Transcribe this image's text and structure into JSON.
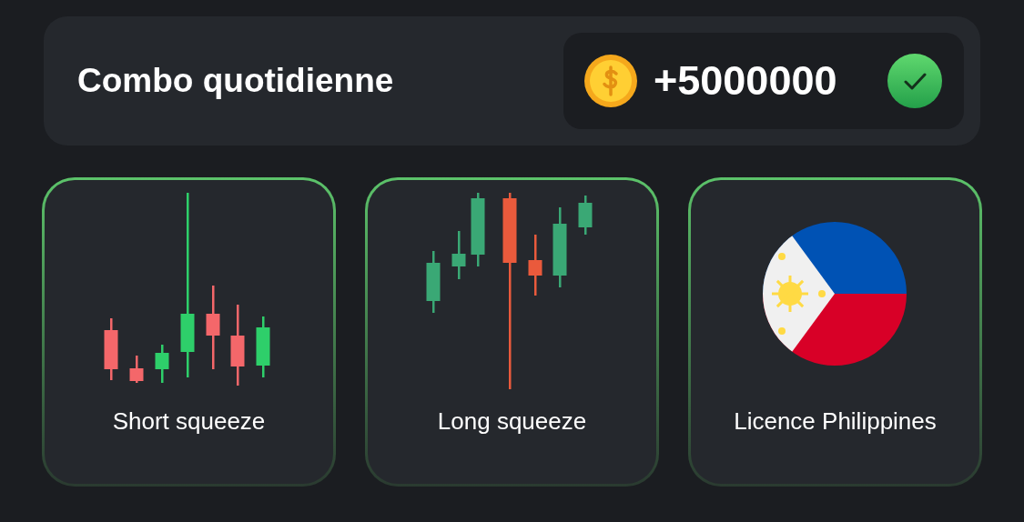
{
  "header": {
    "title": "Combo quotidienne",
    "reward": "+5000000",
    "claimed": true
  },
  "cards": [
    {
      "label": "Short squeeze",
      "found": true
    },
    {
      "label": "Long squeeze",
      "found": true
    },
    {
      "label": "Licence Philippines",
      "found": true
    }
  ]
}
